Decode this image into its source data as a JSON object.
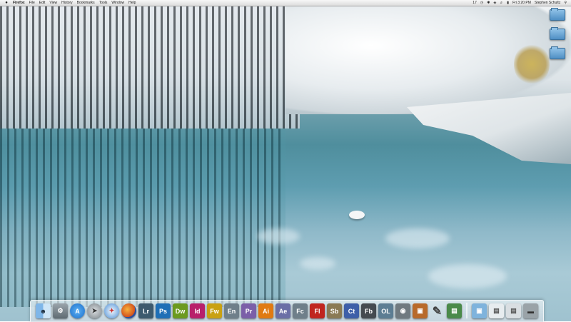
{
  "menubar": {
    "app_name": "Firefox",
    "menus": [
      "File",
      "Edit",
      "View",
      "History",
      "Bookmarks",
      "Tools",
      "Window",
      "Help"
    ],
    "status": {
      "extra": "17",
      "clock": "Fri 3:20 PM",
      "user": "Stephen Schultz"
    }
  },
  "desktop_icons": [
    "folder-icon",
    "folder-icon",
    "folder-icon"
  ],
  "dock": {
    "apps": [
      {
        "label": "",
        "icon": "finder-icon",
        "color": "#7fb6e8"
      },
      {
        "label": "",
        "icon": "system-preferences-icon",
        "color": "#7d858a"
      },
      {
        "label": "",
        "icon": "app-store-icon",
        "color": "#1d6fc9"
      },
      {
        "label": "",
        "icon": "launchpad-icon",
        "color": "#9aa4ab"
      },
      {
        "label": "",
        "icon": "safari-icon",
        "color": "#4b8fd8"
      },
      {
        "label": "",
        "icon": "firefox-icon",
        "color": "#d2501d"
      },
      {
        "label": "Lr",
        "icon": "lightroom-icon",
        "color": "#3d5a6e"
      },
      {
        "label": "Ps",
        "icon": "photoshop-icon",
        "color": "#1f6fb6"
      },
      {
        "label": "Dw",
        "icon": "dreamweaver-icon",
        "color": "#6b9a1f"
      },
      {
        "label": "Id",
        "icon": "indesign-icon",
        "color": "#b8206b"
      },
      {
        "label": "Fw",
        "icon": "fireworks-icon",
        "color": "#c9a112"
      },
      {
        "label": "En",
        "icon": "encore-icon",
        "color": "#6f7f8a"
      },
      {
        "label": "Pr",
        "icon": "premiere-icon",
        "color": "#7b5fa8"
      },
      {
        "label": "Ai",
        "icon": "illustrator-icon",
        "color": "#e07a12"
      },
      {
        "label": "Ae",
        "icon": "after-effects-icon",
        "color": "#6b6fa6"
      },
      {
        "label": "Fc",
        "icon": "flash-catalyst-icon",
        "color": "#6f7f8a"
      },
      {
        "label": "Fl",
        "icon": "flash-icon",
        "color": "#c0251f"
      },
      {
        "label": "Sb",
        "icon": "soundbooth-icon",
        "color": "#8a7a55"
      },
      {
        "label": "Ct",
        "icon": "contribute-icon",
        "color": "#3e5fa8"
      },
      {
        "label": "Fb",
        "icon": "flash-builder-icon",
        "color": "#444a50"
      },
      {
        "label": "OL",
        "icon": "onlocation-icon",
        "color": "#5c7d93"
      },
      {
        "label": "",
        "icon": "disk-utility-icon",
        "color": "#707a80"
      },
      {
        "label": "",
        "icon": "presentation-icon",
        "color": "#b86a2a"
      },
      {
        "label": "",
        "icon": "script-editor-icon",
        "color": "#3a4a66"
      },
      {
        "label": "",
        "icon": "grapher-icon",
        "color": "#4a8a4a"
      }
    ],
    "stacks": [
      {
        "icon": "applications-folder-icon",
        "color": "#7fb3dc"
      },
      {
        "icon": "documents-stack-icon",
        "color": "#e7ecef"
      },
      {
        "icon": "downloads-stack-icon",
        "color": "#d9dee2"
      },
      {
        "icon": "trash-icon",
        "color": "#9aa3a8"
      }
    ]
  }
}
